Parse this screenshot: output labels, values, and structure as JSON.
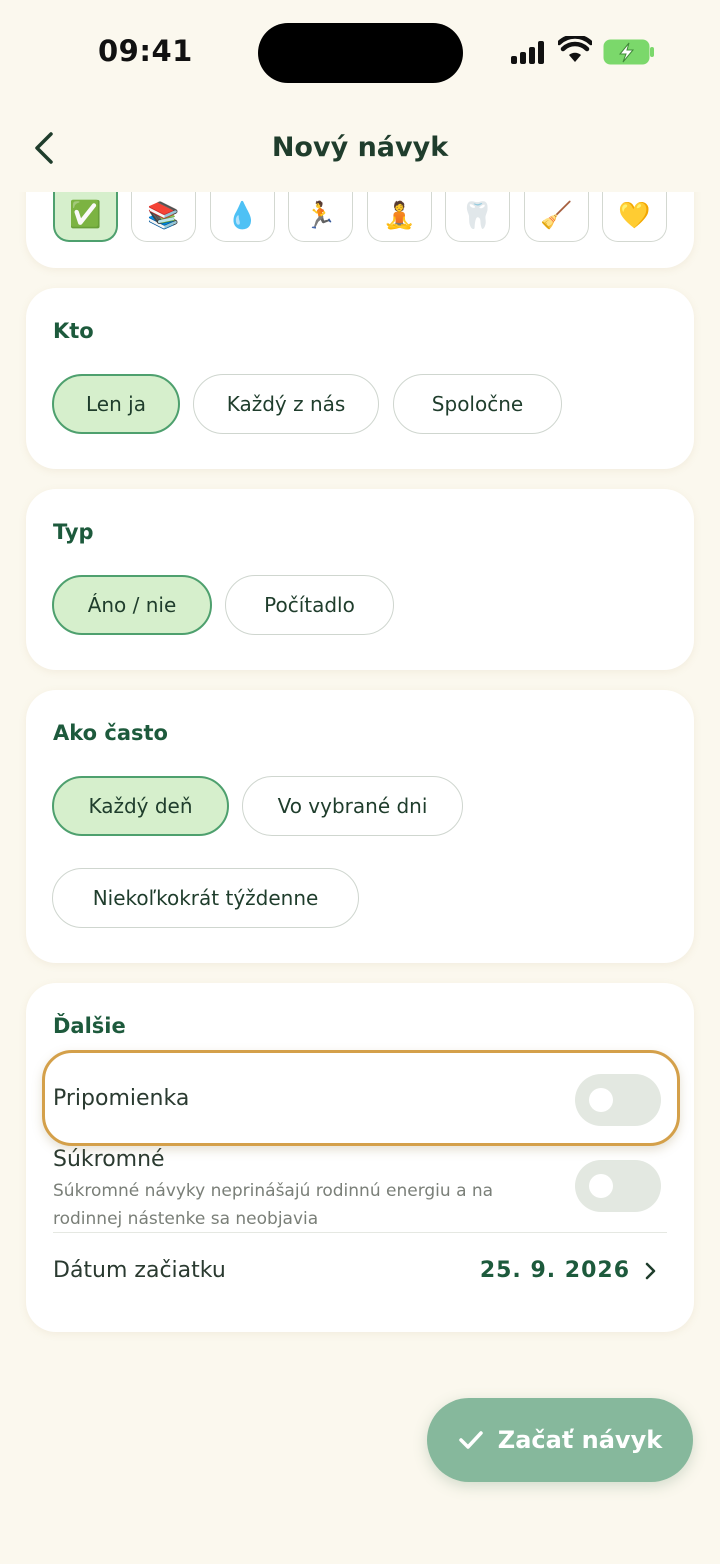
{
  "status": {
    "time": "09:41"
  },
  "nav": {
    "title": "Nový návyk"
  },
  "emojis": [
    "✅",
    "📚",
    "💧",
    "🏃",
    "🧘",
    "🦷",
    "🧹",
    "💛"
  ],
  "who": {
    "label": "Kto",
    "options": [
      "Len ja",
      "Každý z nás",
      "Spoločne"
    ],
    "selected": "Len ja"
  },
  "type": {
    "label": "Typ",
    "options": [
      "Áno / nie",
      "Počítadlo"
    ],
    "selected": "Áno / nie"
  },
  "frequency": {
    "label": "Ako často",
    "options": [
      "Každý deň",
      "Vo vybrané dni",
      "Niekoľkokrát týždenne"
    ],
    "selected": "Každý deň"
  },
  "more": {
    "label": "Ďalšie",
    "reminder": {
      "label": "Pripomienka",
      "on": false
    },
    "private": {
      "label": "Súkromné",
      "description": "Súkromné návyky neprinášajú rodinnú energiu a na rodinnej nástenke sa neobjavia",
      "on": false
    },
    "start_date": {
      "label": "Dátum začiatku",
      "value": "25. 9. 2026"
    }
  },
  "submit": {
    "label": "Začať návyk"
  },
  "colors": {
    "accent": "#1d5a3c",
    "selected_bg": "#d6efcc",
    "selected_border": "#4ea06e",
    "fab": "#86b89c",
    "highlight": "#d4a04a"
  }
}
